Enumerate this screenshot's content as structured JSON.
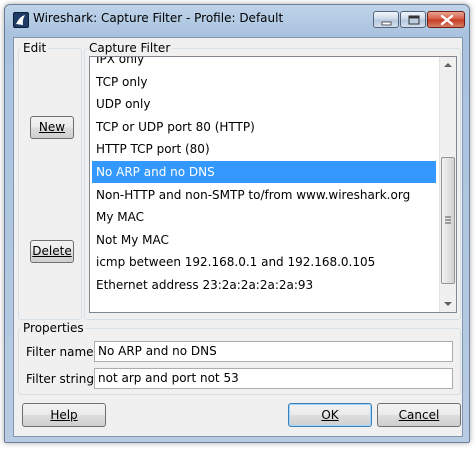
{
  "window": {
    "title": "Wireshark: Capture Filter - Profile: Default",
    "app_icon": "wireshark-fin-icon",
    "controls": [
      "minimize-icon",
      "maximize-icon",
      "close-icon"
    ]
  },
  "edit": {
    "label": "Edit",
    "new_button": "New",
    "delete_button": "Delete"
  },
  "capture_filter": {
    "label": "Capture Filter",
    "items": [
      "IPX only",
      "TCP only",
      "UDP only",
      "TCP or UDP port 80 (HTTP)",
      "HTTP TCP port (80)",
      "No ARP and no DNS",
      "Non-HTTP and non-SMTP to/from www.wireshark.org",
      "My MAC",
      "Not My MAC",
      "icmp between 192.168.0.1 and 192.168.0.105",
      "Ethernet address 23:2a:2a:2a:2a:93"
    ],
    "selected_index": 5
  },
  "properties": {
    "label": "Properties",
    "filter_name_label": "Filter name:",
    "filter_name_value": "No ARP and no DNS",
    "filter_string_label": "Filter string:",
    "filter_string_value": "not arp and port not 53"
  },
  "footer": {
    "help_button": "Help",
    "ok_button": "OK",
    "cancel_button": "Cancel"
  },
  "colors": {
    "selection": "#3399ff",
    "close_button": "#c13b20"
  }
}
